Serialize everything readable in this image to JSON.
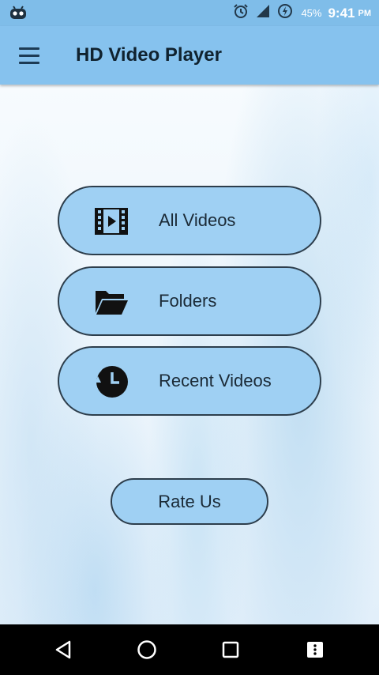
{
  "status_bar": {
    "battery_percent": "45%",
    "time": "9:41",
    "ampm": "PM",
    "left_icon": "android-debug-icon",
    "icons": [
      "alarm-icon",
      "signal-icon",
      "battery-charging-icon"
    ]
  },
  "app_bar": {
    "title": "HD Video Player",
    "menu_icon": "hamburger-menu-icon"
  },
  "menu": {
    "items": [
      {
        "label": "All Videos",
        "icon": "film-play-icon"
      },
      {
        "label": "Folders",
        "icon": "open-folder-icon"
      },
      {
        "label": "Recent Videos",
        "icon": "history-clock-icon"
      }
    ],
    "rate_label": "Rate Us"
  },
  "nav_bar": {
    "buttons": [
      "back-icon",
      "home-icon",
      "recents-icon",
      "menu-dots-icon"
    ]
  },
  "colors": {
    "status_bar": "#7fbde9",
    "app_bar": "#86c2ee",
    "pill_fill": "#9fd0f3",
    "pill_border": "#2d3e4c",
    "nav_bar": "#000000"
  }
}
